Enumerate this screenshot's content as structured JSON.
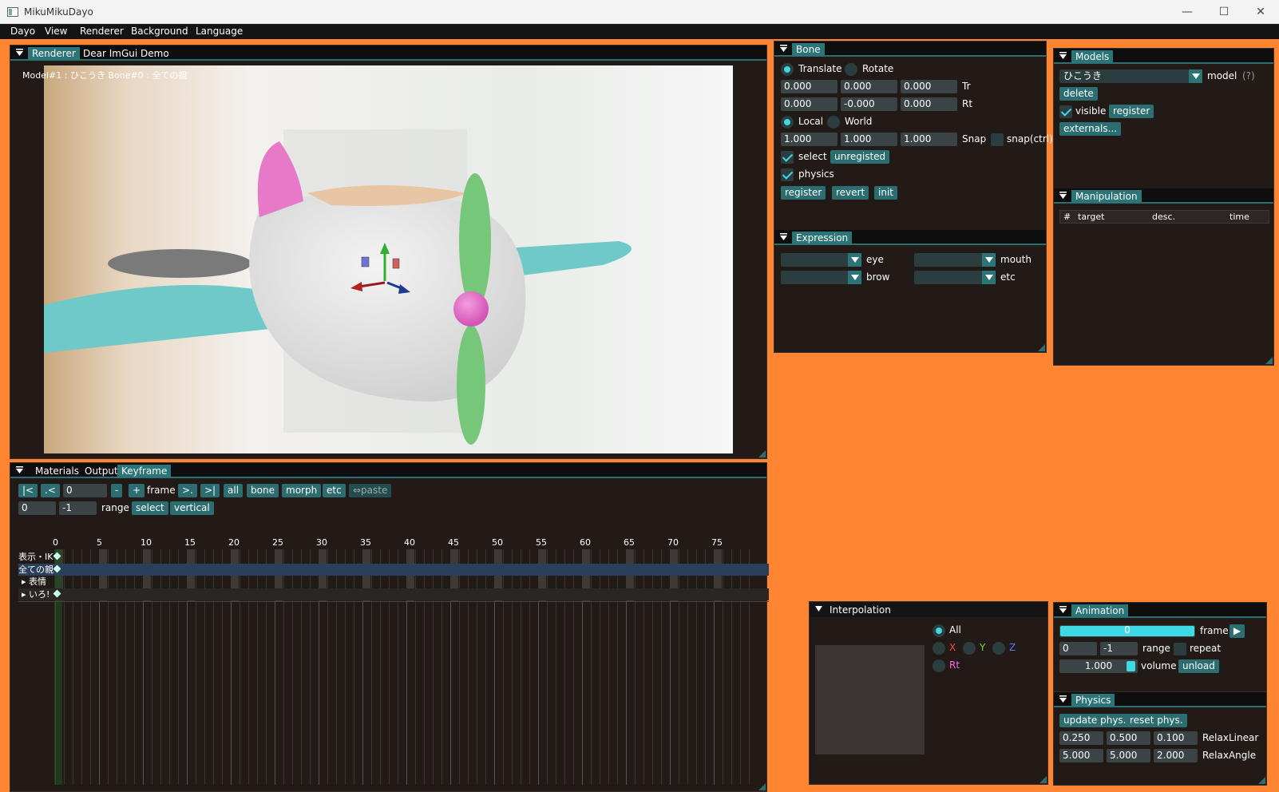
{
  "window": {
    "title": "MikuMikuDayo",
    "min_glyph": "—",
    "max_glyph": "☐",
    "close_glyph": "✕"
  },
  "menu": [
    "Dayo",
    "View",
    "Renderer",
    "Background",
    "Language"
  ],
  "renderer": {
    "tabs": [
      "Renderer",
      "Dear ImGui Demo"
    ],
    "overlay_text": "Model#1 : ひこうき Bone#0 : 全ての親"
  },
  "bone": {
    "title": "Bone",
    "translate": "Translate",
    "rotate": "Rotate",
    "tr_values": [
      "0.000",
      "0.000",
      "0.000"
    ],
    "tr_label": "Tr",
    "rt_values": [
      "0.000",
      "-0.000",
      "0.000"
    ],
    "rt_label": "Rt",
    "local": "Local",
    "world": "World",
    "snap_values": [
      "1.000",
      "1.000",
      "1.000"
    ],
    "snap_label": "Snap",
    "snap_ctrl": "snap(ctrl)",
    "select": "select",
    "unregisted": "unregisted",
    "physics": "physics",
    "register": "register",
    "revert": "revert",
    "init": "init"
  },
  "expression": {
    "title": "Expression",
    "eye": "eye",
    "mouth": "mouth",
    "brow": "brow",
    "etc": "etc"
  },
  "models": {
    "title": "Models",
    "model_value": "ひこうき",
    "model_label": "model",
    "help": "(?)",
    "delete": "delete",
    "visible": "visible",
    "register": "register",
    "externals": "externals..."
  },
  "manipulation": {
    "title": "Manipulation",
    "columns": [
      "#",
      "target",
      "desc.",
      "time"
    ]
  },
  "keyframe": {
    "tabs": [
      "Materials",
      "Output",
      "Keyframe"
    ],
    "first": "|<",
    "prev": ".<",
    "frame_value": "0",
    "minus": "-",
    "plus": "+",
    "frame_label": "frame",
    "next": ">.",
    "last": ">|",
    "all": "all",
    "bone": "bone",
    "morph": "morph",
    "etc": "etc",
    "paste": "⇔paste",
    "range_start": "0",
    "range_end": "-1",
    "range_label": "range",
    "select": "select",
    "vertical": "vertical",
    "ticks": [
      "0",
      "5",
      "10",
      "15",
      "20",
      "25",
      "30",
      "35",
      "40",
      "45",
      "50",
      "55",
      "60",
      "65",
      "70",
      "75"
    ],
    "rows": [
      "表示・IK",
      "全ての親",
      "▸ 表情",
      "▸ いろ!"
    ]
  },
  "interpolation": {
    "title": "Interpolation",
    "all": "All",
    "x": "X",
    "y": "Y",
    "z": "Z",
    "rt": "Rt"
  },
  "animation": {
    "title": "Animation",
    "frame_value": "0",
    "frame_label": "frame",
    "play_glyph": "▶",
    "range_start": "0",
    "range_end": "-1",
    "range_label": "range",
    "repeat": "repeat",
    "volume_value": "1.000",
    "volume_label": "volume",
    "unload": "unload"
  },
  "physics": {
    "title": "Physics",
    "update": "update phys.",
    "reset": "reset phys.",
    "linear": [
      "0.250",
      "0.500",
      "0.100"
    ],
    "linear_label": "RelaxLinear",
    "angle": [
      "5.000",
      "5.000",
      "2.000"
    ],
    "angle_label": "RelaxAngle"
  },
  "colors": {
    "background": "#FF8533",
    "accent": "#2b7478",
    "check": "#3fd9e6"
  }
}
